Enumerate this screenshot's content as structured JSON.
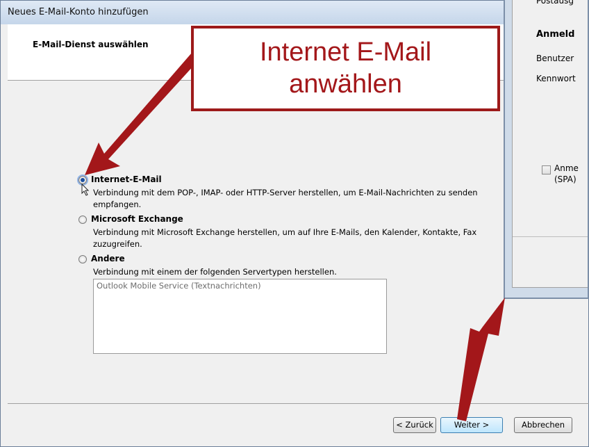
{
  "window": {
    "title": "Neues E-Mail-Konto hinzufügen",
    "header_title": "E-Mail-Dienst auswählen"
  },
  "options": [
    {
      "label": "Internet-E-Mail",
      "selected": true,
      "description_line1": "Verbindung mit dem POP-, IMAP- oder HTTP-Server herstellen, um E-Mail-Nachrichten zu senden",
      "description_line2": "empfangen."
    },
    {
      "label": "Microsoft Exchange",
      "selected": false,
      "description_line1": "Verbindung mit Microsoft Exchange herstellen, um auf Ihre E-Mails, den Kalender, Kontakte, Fax",
      "description_line2": "zuzugreifen."
    },
    {
      "label": "Andere",
      "selected": false,
      "description_line1": "Verbindung mit einem der folgenden Servertypen herstellen."
    }
  ],
  "server_types_list": [
    "Outlook Mobile Service (Textnachrichten)"
  ],
  "buttons": {
    "back": "< Zurück",
    "next": "Weiter >",
    "cancel": "Abbrechen"
  },
  "background_window": {
    "top_text": "Postausg",
    "section_title": "Anmeld",
    "user_label": "Benutzer",
    "password_label": "Kennwort",
    "spa_label_line1": "Anme",
    "spa_label_line2": "(SPA)"
  },
  "annotation": {
    "line1": "Internet E-Mail",
    "line2": "anwählen",
    "color": "#a3171a"
  }
}
